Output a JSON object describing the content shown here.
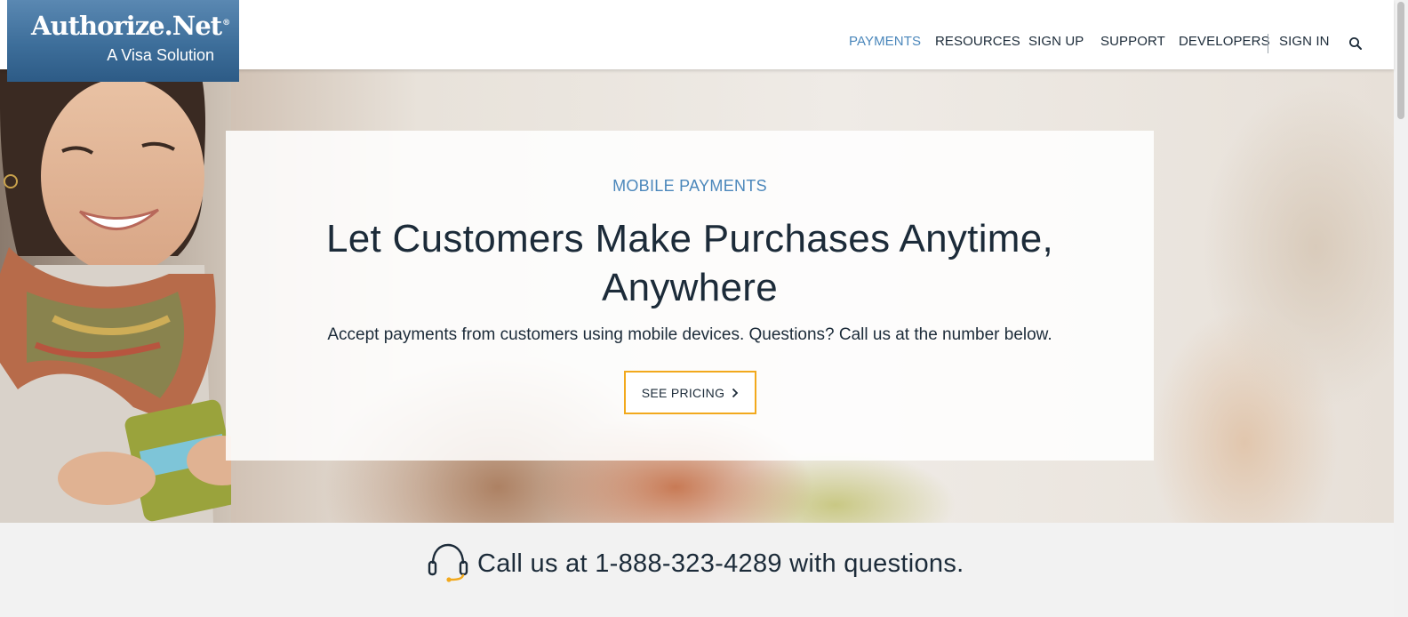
{
  "header": {
    "logo": {
      "name": "Authorize.Net",
      "registered": "®",
      "tagline": "A Visa Solution"
    },
    "nav": [
      {
        "label": "PAYMENTS",
        "active": true
      },
      {
        "label": "RESOURCES"
      },
      {
        "label": "SIGN UP"
      },
      {
        "label": "SUPPORT"
      },
      {
        "label": "DEVELOPERS"
      },
      {
        "label": "SIGN IN"
      }
    ],
    "search_icon": "search-icon"
  },
  "hero": {
    "eyebrow": "MOBILE PAYMENTS",
    "headline_line1": "Let Customers Make Purchases Anytime,",
    "headline_line2": "Anywhere",
    "subtext": "Accept payments from customers using mobile devices. Questions? Call us at the number below.",
    "cta_label": "SEE PRICING",
    "cta_icon": "chevron-right-icon"
  },
  "callbar": {
    "icon": "headset-icon",
    "text": "Call us at 1-888-323-4289 with questions."
  },
  "colors": {
    "brand_blue": "#3d6e9a",
    "active_nav": "#4b87bb",
    "text_dark": "#1c2b39",
    "cta_border": "#f2a91d",
    "callbar_bg": "#f2f2f2"
  }
}
